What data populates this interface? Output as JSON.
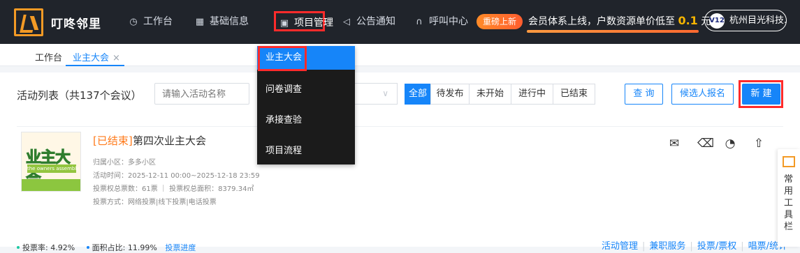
{
  "brand": {
    "name": "叮咚邻里"
  },
  "nav": {
    "workbench": "工作台",
    "basic_info": "基础信息",
    "project_management": "项目管理",
    "announcements": "公告通知",
    "call_center": "呼叫中心"
  },
  "promo": {
    "badge": "重磅上新",
    "text_before": "会员体系上线，户数资源单价低至",
    "price": "0.1",
    "text_after": "元!"
  },
  "account": {
    "vip": "V12",
    "name": "杭州目光科技..."
  },
  "tabs": [
    {
      "label": "工作台"
    },
    {
      "label": "业主大会",
      "close": "×"
    }
  ],
  "list": {
    "title": "活动列表（共137个会议）",
    "search_placeholder": "请输入活动名称",
    "select_value": "∨"
  },
  "filters": [
    "全部",
    "待发布",
    "未开始",
    "进行中",
    "已结束"
  ],
  "buttons": {
    "query": "查 询",
    "candidate": "候选人报名",
    "new": "新 建"
  },
  "dropdown_menu": [
    "业主大会",
    "问卷调查",
    "承接查验",
    "项目流程"
  ],
  "meeting": {
    "status": "[已结束]",
    "title": "第四次业主大会",
    "poster_title": "业主大会",
    "poster_subtitle": "the owners assembly",
    "community": "归属小区：多多小区",
    "time": "活动时间：2025-12-11 00:00~2025-12-18 23:59",
    "votes": "投票权总票数：61票 ｜ 投票权总面积：8379.34㎡",
    "method": "投票方式：网络投票|线下投票|电话投票",
    "vote_rate_label": "投票率:",
    "vote_rate": "4.92%",
    "area_label": "面积占比:",
    "area_rate": "11.99%",
    "progress_link": "投票进度",
    "links": [
      "活动管理",
      "兼职服务",
      "投票/票权",
      "唱票/统计"
    ]
  },
  "right_tool": {
    "label": "常用工具栏"
  }
}
